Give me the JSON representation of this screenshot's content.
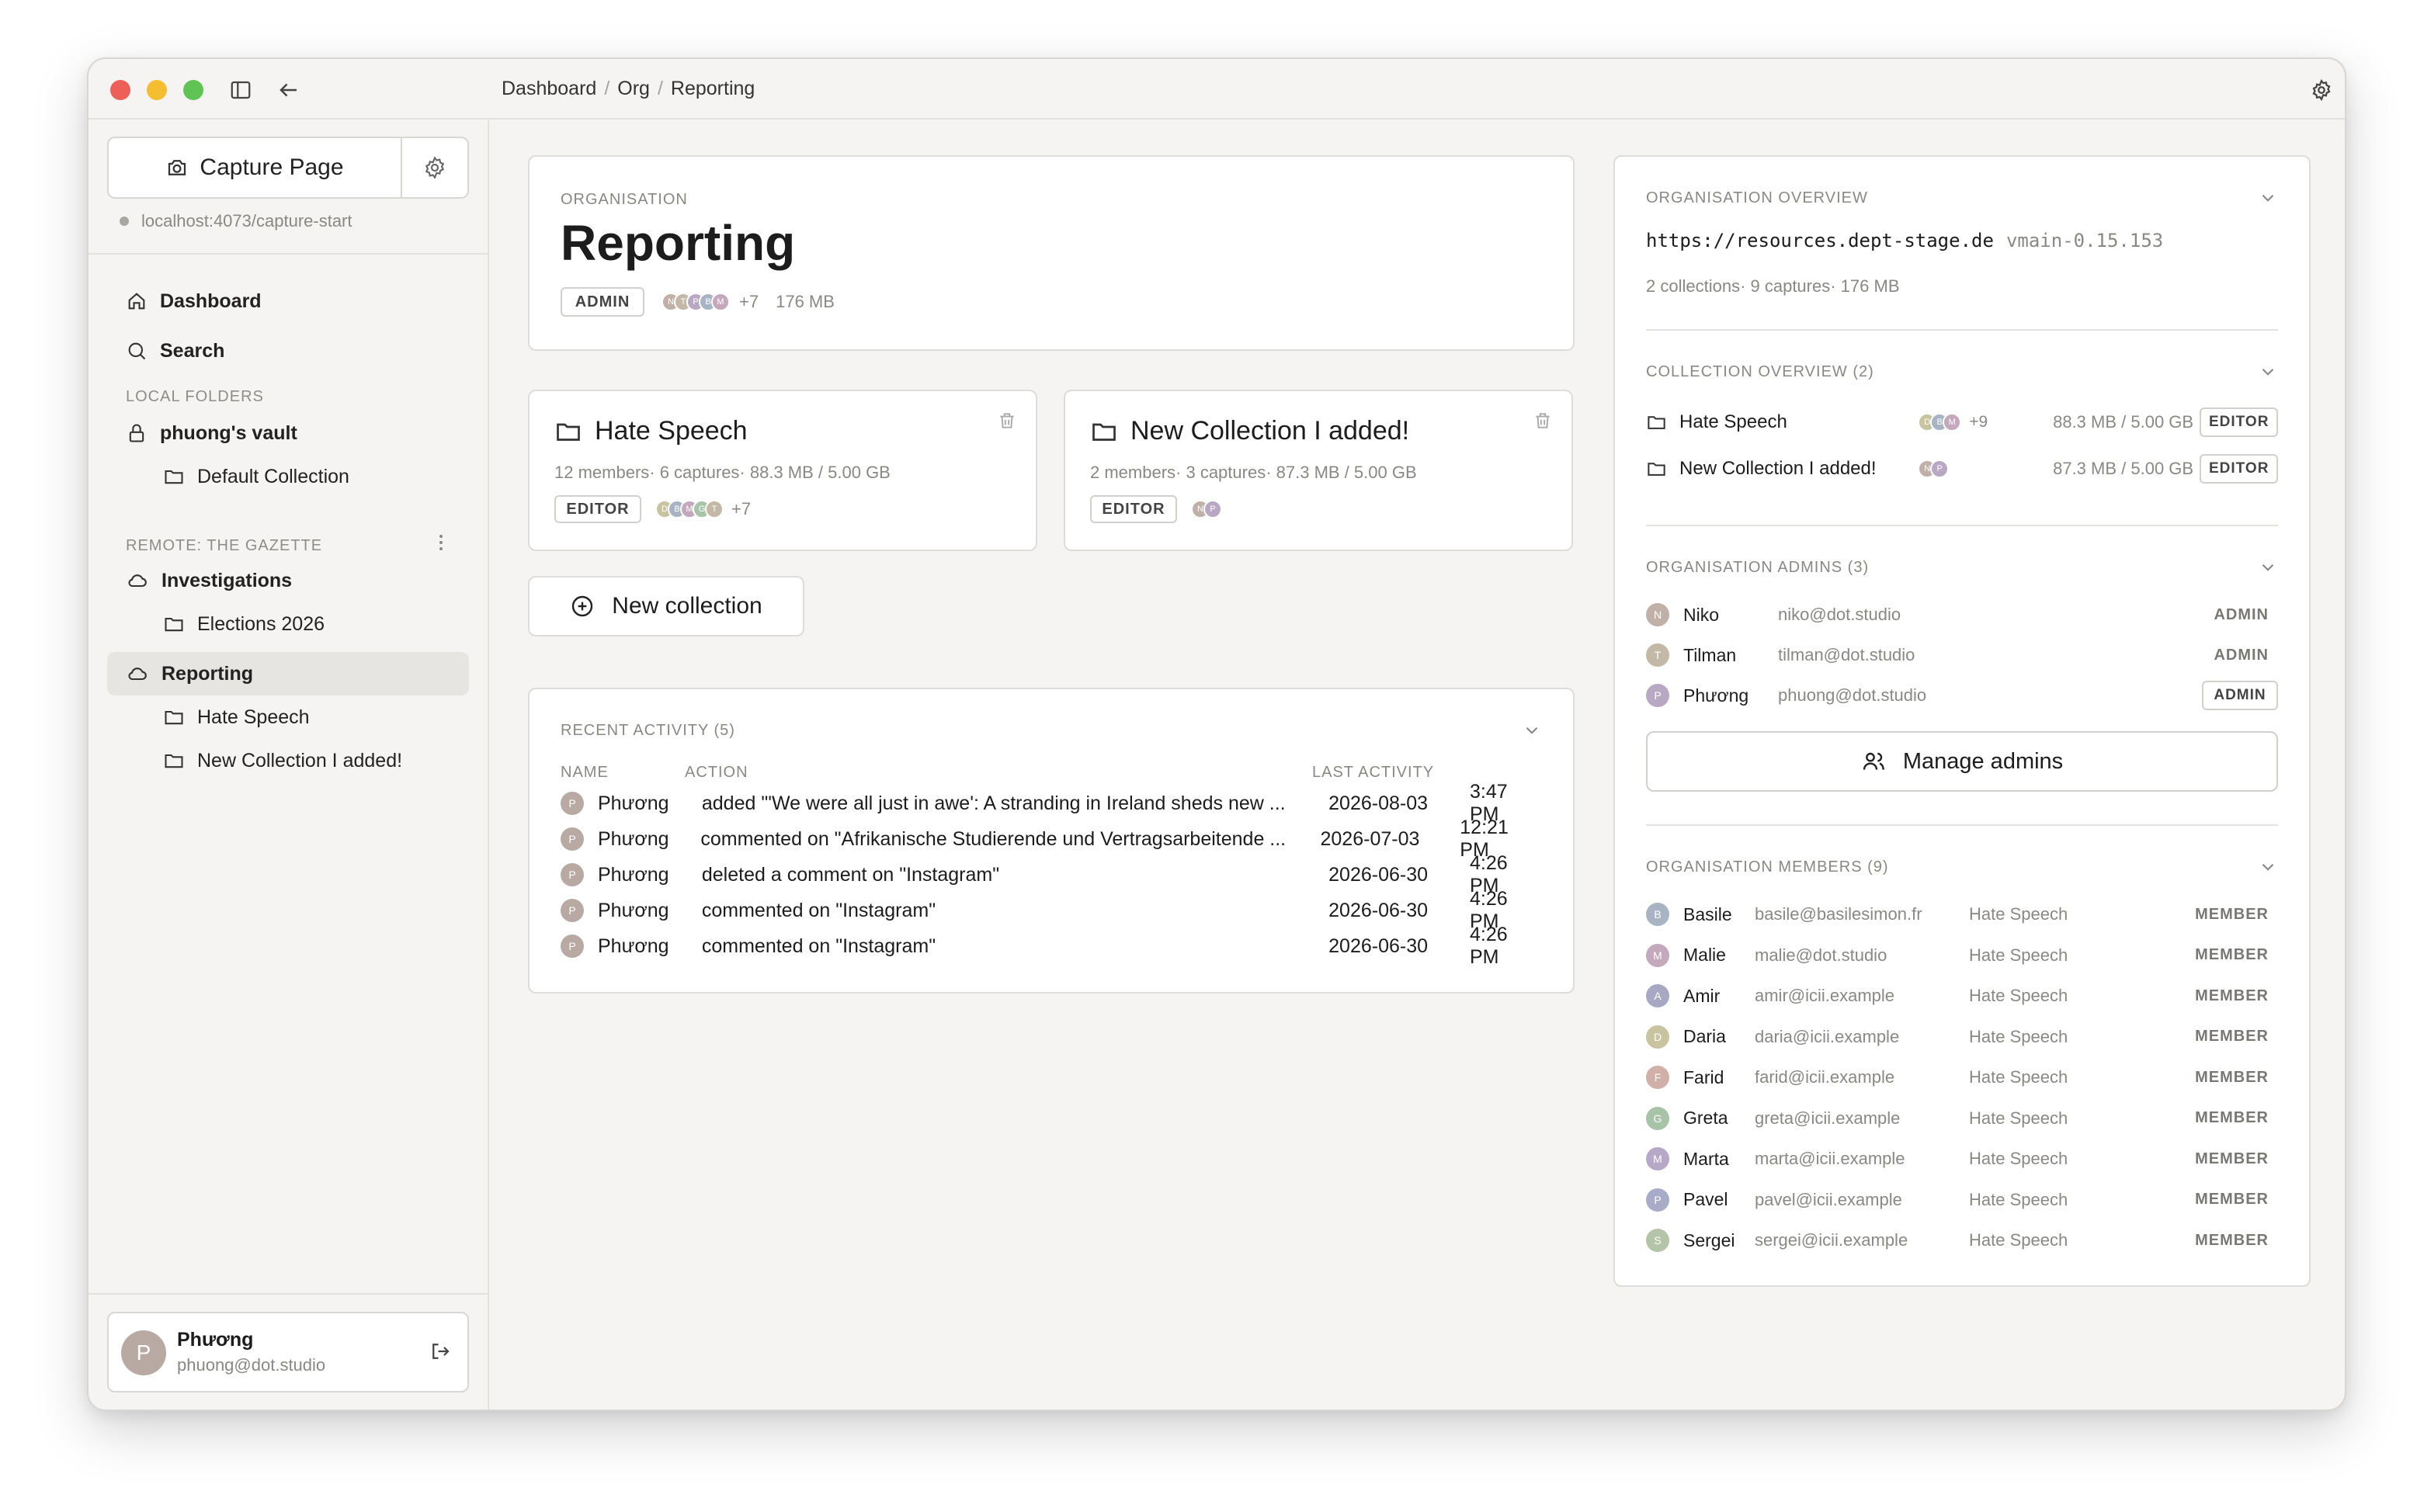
{
  "breadcrumb": [
    "Dashboard",
    "Org",
    "Reporting"
  ],
  "sidebar": {
    "capture_label": "Capture Page",
    "capture_url": "localhost:4073/capture-start",
    "nav": [
      {
        "label": "Dashboard",
        "icon": "home-icon"
      },
      {
        "label": "Search",
        "icon": "search-icon"
      }
    ],
    "local_label": "LOCAL FOLDERS",
    "vault": "phuong's vault",
    "vault_child": "Default Collection",
    "remote_label": "REMOTE: THE GAZETTE",
    "remote_items": [
      {
        "label": "Investigations",
        "children": [
          "Elections 2026"
        ]
      },
      {
        "label": "Reporting",
        "active": true,
        "children": [
          "Hate Speech",
          "New Collection I added!"
        ]
      }
    ],
    "user": {
      "initial": "P",
      "name": "Phương",
      "email": "phuong@dot.studio"
    }
  },
  "org": {
    "label": "ORGANISATION",
    "title": "Reporting",
    "role": "ADMIN",
    "avatars": [
      "N",
      "T",
      "P",
      "B",
      "M"
    ],
    "extra": "+7",
    "size": "176 MB"
  },
  "collections": [
    {
      "title": "Hate Speech",
      "meta": "12 members· 6 captures· 88.3 MB / 5.00 GB",
      "role": "EDITOR",
      "avatars": [
        "D",
        "B",
        "M",
        "G",
        "T"
      ],
      "extra": "+7"
    },
    {
      "title": "New Collection I added!",
      "meta": "2 members· 3 captures· 87.3 MB / 5.00 GB",
      "role": "EDITOR",
      "avatars": [
        "N",
        "P"
      ],
      "extra": ""
    }
  ],
  "new_collection_label": "New collection",
  "activity": {
    "title": "RECENT ACTIVITY (5)",
    "headers": {
      "name": "NAME",
      "action": "ACTION",
      "last": "LAST ACTIVITY"
    },
    "rows": [
      {
        "initial": "P",
        "name": "Phương",
        "action": "added \"'We were all just in awe': A stranding in Ireland sheds new ...",
        "date": "2026-08-03",
        "time": "3:47 PM"
      },
      {
        "initial": "P",
        "name": "Phương",
        "action": "commented on \"Afrikanische Studierende und Vertragsarbeitende ...",
        "date": "2026-07-03",
        "time": "12:21 PM"
      },
      {
        "initial": "P",
        "name": "Phương",
        "action": "deleted a comment on \"Instagram\"",
        "date": "2026-06-30",
        "time": "4:26 PM"
      },
      {
        "initial": "P",
        "name": "Phương",
        "action": "commented on \"Instagram\"",
        "date": "2026-06-30",
        "time": "4:26 PM"
      },
      {
        "initial": "P",
        "name": "Phương",
        "action": "commented on \"Instagram\"",
        "date": "2026-06-30",
        "time": "4:26 PM"
      }
    ]
  },
  "overview": {
    "title": "ORGANISATION OVERVIEW",
    "url": "https://resources.dept-stage.de",
    "version": "vmain-0.15.153",
    "stats": "2 collections· 9 captures· 176 MB",
    "collections_title": "COLLECTION OVERVIEW (2)",
    "collections": [
      {
        "name": "Hate Speech",
        "avatars": [
          "D",
          "B",
          "M"
        ],
        "extra": "+9",
        "size": "88.3 MB / 5.00 GB",
        "role": "EDITOR"
      },
      {
        "name": "New Collection I added!",
        "avatars": [
          "N",
          "P"
        ],
        "extra": "",
        "size": "87.3 MB / 5.00 GB",
        "role": "EDITOR"
      }
    ],
    "admins_title": "ORGANISATION ADMINS (3)",
    "admins": [
      {
        "initial": "N",
        "name": "Niko",
        "email": "niko@dot.studio",
        "role": "ADMIN",
        "boxed": false
      },
      {
        "initial": "T",
        "name": "Tilman",
        "email": "tilman@dot.studio",
        "role": "ADMIN",
        "boxed": false
      },
      {
        "initial": "P",
        "name": "Phương",
        "email": "phuong@dot.studio",
        "role": "ADMIN",
        "boxed": true
      }
    ],
    "manage_label": "Manage admins",
    "members_title": "ORGANISATION MEMBERS (9)",
    "members": [
      {
        "initial": "B",
        "name": "Basile",
        "email": "basile@basilesimon.fr",
        "collection": "Hate Speech",
        "role": "MEMBER",
        "color": "#a8b4c4"
      },
      {
        "initial": "M",
        "name": "Malie",
        "email": "malie@dot.studio",
        "collection": "Hate Speech",
        "role": "MEMBER",
        "color": "#c4a8bc"
      },
      {
        "initial": "A",
        "name": "Amir",
        "email": "amir@icii.example",
        "collection": "Hate Speech",
        "role": "MEMBER",
        "color": "#a8a8c4"
      },
      {
        "initial": "D",
        "name": "Daria",
        "email": "daria@icii.example",
        "collection": "Hate Speech",
        "role": "MEMBER",
        "color": "#c8c4a0"
      },
      {
        "initial": "F",
        "name": "Farid",
        "email": "farid@icii.example",
        "collection": "Hate Speech",
        "role": "MEMBER",
        "color": "#d0b0a8"
      },
      {
        "initial": "G",
        "name": "Greta",
        "email": "greta@icii.example",
        "collection": "Hate Speech",
        "role": "MEMBER",
        "color": "#a8c4a8"
      },
      {
        "initial": "M",
        "name": "Marta",
        "email": "marta@icii.example",
        "collection": "Hate Speech",
        "role": "MEMBER",
        "color": "#b8a8c8"
      },
      {
        "initial": "P",
        "name": "Pavel",
        "email": "pavel@icii.example",
        "collection": "Hate Speech",
        "role": "MEMBER",
        "color": "#a8acc8"
      },
      {
        "initial": "S",
        "name": "Sergei",
        "email": "sergei@icii.example",
        "collection": "Hate Speech",
        "role": "MEMBER",
        "color": "#b4c4a8"
      }
    ]
  },
  "colors": {
    "background": "#f5f4f2",
    "card": "#ffffff",
    "border": "#dedcd8",
    "active_nav": "#e7e5e2",
    "avatar_default": "#b8aaa2",
    "muted_text": "#8a8884"
  }
}
